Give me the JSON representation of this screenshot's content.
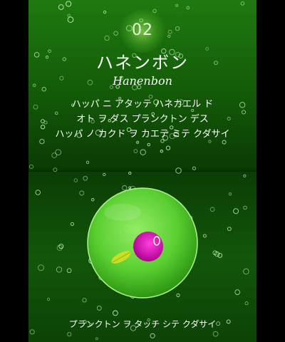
{
  "top_screen": {
    "stage_number": "02",
    "title": "ハネンボン",
    "title_romaji": "Hanenbon",
    "description_lines": [
      "ハッパ ニ アタッテ ハネカエル ド",
      "オト ヲ ダス プランクトン デス",
      "ハッパ ノ カクド ヲ カエテ ミテ クダサイ"
    ]
  },
  "bottom_screen": {
    "instruction": "プランクトン ヲ タッチ シテ クダサイ"
  },
  "colors": {
    "top_bg": "#1f7a10",
    "bottom_bg": "#12560a",
    "sphere": "#6fe640",
    "plankton": "#d000a8",
    "leaf": "#c8e020"
  },
  "icons": {
    "sphere": "green-sphere-icon",
    "plankton": "magenta-plankton-icon",
    "leaf": "yellow-leaf-icon"
  }
}
